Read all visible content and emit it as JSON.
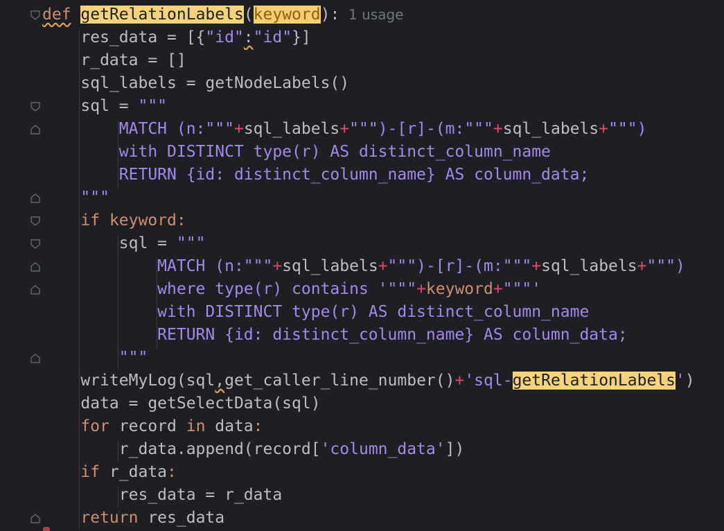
{
  "editor": {
    "usage_hint": "1 usage",
    "lines": [
      {
        "indent": "",
        "tokens": [
          {
            "t": "def",
            "c": "kw squig"
          },
          {
            "t": " ",
            "c": ""
          },
          {
            "t": "getRelationLabels",
            "c": "hl-fn"
          },
          {
            "t": "(",
            "c": ""
          },
          {
            "t": "keyword",
            "c": "hl-param"
          },
          {
            "t": "):",
            "c": ""
          }
        ],
        "usage": true
      },
      {
        "indent": "    ",
        "tokens": [
          {
            "t": "res_data = [{",
            "c": ""
          },
          {
            "t": "\"id\"",
            "c": "str"
          },
          {
            "t": ":",
            "c": "squig"
          },
          {
            "t": "\"id\"",
            "c": "str"
          },
          {
            "t": "}]",
            "c": ""
          }
        ]
      },
      {
        "indent": "    ",
        "tokens": [
          {
            "t": "r_data = []",
            "c": ""
          }
        ]
      },
      {
        "indent": "    ",
        "tokens": [
          {
            "t": "sql_labels = getNodeLabels()",
            "c": ""
          }
        ]
      },
      {
        "indent": "    ",
        "tokens": [
          {
            "t": "sql = ",
            "c": ""
          },
          {
            "t": "\"\"\"",
            "c": "str"
          }
        ]
      },
      {
        "indent": "        ",
        "tokens": [
          {
            "t": "MATCH (n:",
            "c": "str"
          },
          {
            "t": "\"\"\"",
            "c": "str"
          },
          {
            "t": "+",
            "c": "op"
          },
          {
            "t": "sql_labels",
            "c": ""
          },
          {
            "t": "+",
            "c": "op"
          },
          {
            "t": "\"\"\"",
            "c": "str"
          },
          {
            "t": ")-[r]-(m:",
            "c": "str"
          },
          {
            "t": "\"\"\"",
            "c": "str"
          },
          {
            "t": "+",
            "c": "op"
          },
          {
            "t": "sql_labels",
            "c": ""
          },
          {
            "t": "+",
            "c": "op"
          },
          {
            "t": "\"\"\"",
            "c": "str"
          },
          {
            "t": ")",
            "c": "str"
          }
        ]
      },
      {
        "indent": "        ",
        "tokens": [
          {
            "t": "with DISTINCT type(r) AS distinct_column_name",
            "c": "str"
          }
        ]
      },
      {
        "indent": "        ",
        "tokens": [
          {
            "t": "RETURN {id: distinct_column_name} AS column_data;",
            "c": "str"
          }
        ]
      },
      {
        "indent": "    ",
        "tokens": [
          {
            "t": "\"\"\"",
            "c": "str"
          }
        ]
      },
      {
        "indent": "    ",
        "tokens": [
          {
            "t": "if",
            "c": "kw"
          },
          {
            "t": " ",
            "c": ""
          },
          {
            "t": "keyword",
            "c": "param"
          },
          {
            "t": ":",
            "c": "kw"
          }
        ]
      },
      {
        "indent": "        ",
        "tokens": [
          {
            "t": "sql = ",
            "c": ""
          },
          {
            "t": "\"\"\"",
            "c": "str"
          }
        ]
      },
      {
        "indent": "            ",
        "tokens": [
          {
            "t": "MATCH (n:",
            "c": "str"
          },
          {
            "t": "\"\"\"",
            "c": "str"
          },
          {
            "t": "+",
            "c": "op"
          },
          {
            "t": "sql_labels",
            "c": ""
          },
          {
            "t": "+",
            "c": "op"
          },
          {
            "t": "\"\"\"",
            "c": "str"
          },
          {
            "t": ")-[r]-(m:",
            "c": "str"
          },
          {
            "t": "\"\"\"",
            "c": "str"
          },
          {
            "t": "+",
            "c": "op"
          },
          {
            "t": "sql_labels",
            "c": ""
          },
          {
            "t": "+",
            "c": "op"
          },
          {
            "t": "\"\"\"",
            "c": "str"
          },
          {
            "t": ")",
            "c": "str"
          }
        ]
      },
      {
        "indent": "            ",
        "tokens": [
          {
            "t": "where type(r) contains '",
            "c": "str"
          },
          {
            "t": "\"\"\"",
            "c": "str"
          },
          {
            "t": "+",
            "c": "op"
          },
          {
            "t": "keyword",
            "c": "param"
          },
          {
            "t": "+",
            "c": "op"
          },
          {
            "t": "\"\"\"",
            "c": "str"
          },
          {
            "t": "'",
            "c": "str"
          }
        ]
      },
      {
        "indent": "            ",
        "tokens": [
          {
            "t": "with DISTINCT type(r) AS distinct_column_name",
            "c": "str"
          }
        ]
      },
      {
        "indent": "            ",
        "tokens": [
          {
            "t": "RETURN {id: distinct_column_name} AS column_data;",
            "c": "str"
          }
        ]
      },
      {
        "indent": "        ",
        "tokens": [
          {
            "t": "\"\"\"",
            "c": "str"
          }
        ]
      },
      {
        "indent": "    ",
        "tokens": [
          {
            "t": "writeMyLog(sql",
            "c": ""
          },
          {
            "t": ",",
            "c": "squig"
          },
          {
            "t": "get_caller_line_number()",
            "c": ""
          },
          {
            "t": "+",
            "c": "op"
          },
          {
            "t": "'sql-",
            "c": "str"
          },
          {
            "t": "getRelationLabels",
            "c": "hl-fn"
          },
          {
            "t": "'",
            "c": "str"
          },
          {
            "t": ")",
            "c": ""
          }
        ]
      },
      {
        "indent": "    ",
        "tokens": [
          {
            "t": "data = getSelectData(sql)",
            "c": ""
          }
        ]
      },
      {
        "indent": "    ",
        "tokens": [
          {
            "t": "for",
            "c": "kw"
          },
          {
            "t": " record ",
            "c": ""
          },
          {
            "t": "in",
            "c": "kw"
          },
          {
            "t": " data",
            "c": ""
          },
          {
            "t": ":",
            "c": "kw"
          }
        ]
      },
      {
        "indent": "        ",
        "tokens": [
          {
            "t": "r_data.append(record[",
            "c": ""
          },
          {
            "t": "'column_data'",
            "c": "str"
          },
          {
            "t": "])",
            "c": ""
          }
        ]
      },
      {
        "indent": "    ",
        "tokens": [
          {
            "t": "if",
            "c": "kw"
          },
          {
            "t": " r_data",
            "c": ""
          },
          {
            "t": ":",
            "c": "kw"
          }
        ]
      },
      {
        "indent": "        ",
        "tokens": [
          {
            "t": "res_data = r_data",
            "c": ""
          }
        ]
      },
      {
        "indent": "    ",
        "tokens": [
          {
            "t": "return",
            "c": "kw"
          },
          {
            "t": " res_data",
            "c": ""
          }
        ]
      }
    ]
  },
  "colors": {
    "background": "#1e1f22",
    "keyword": "#cf8e6d",
    "string": "#a588ed",
    "operator": "#e5466b",
    "text": "#bcbec4",
    "highlight": "#f5d27c"
  }
}
